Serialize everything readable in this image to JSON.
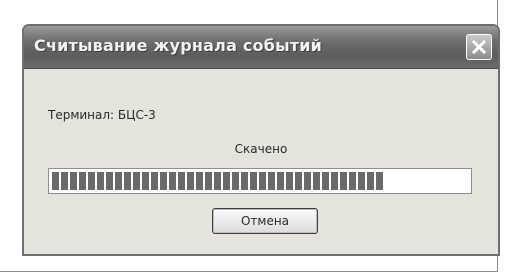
{
  "dialog": {
    "title": "Считывание журнала событий",
    "terminal_text": "Терминал: БЦС-3",
    "status_text": "Скачено",
    "progress_fraction": 0.8,
    "cancel_label": "Отмена"
  }
}
